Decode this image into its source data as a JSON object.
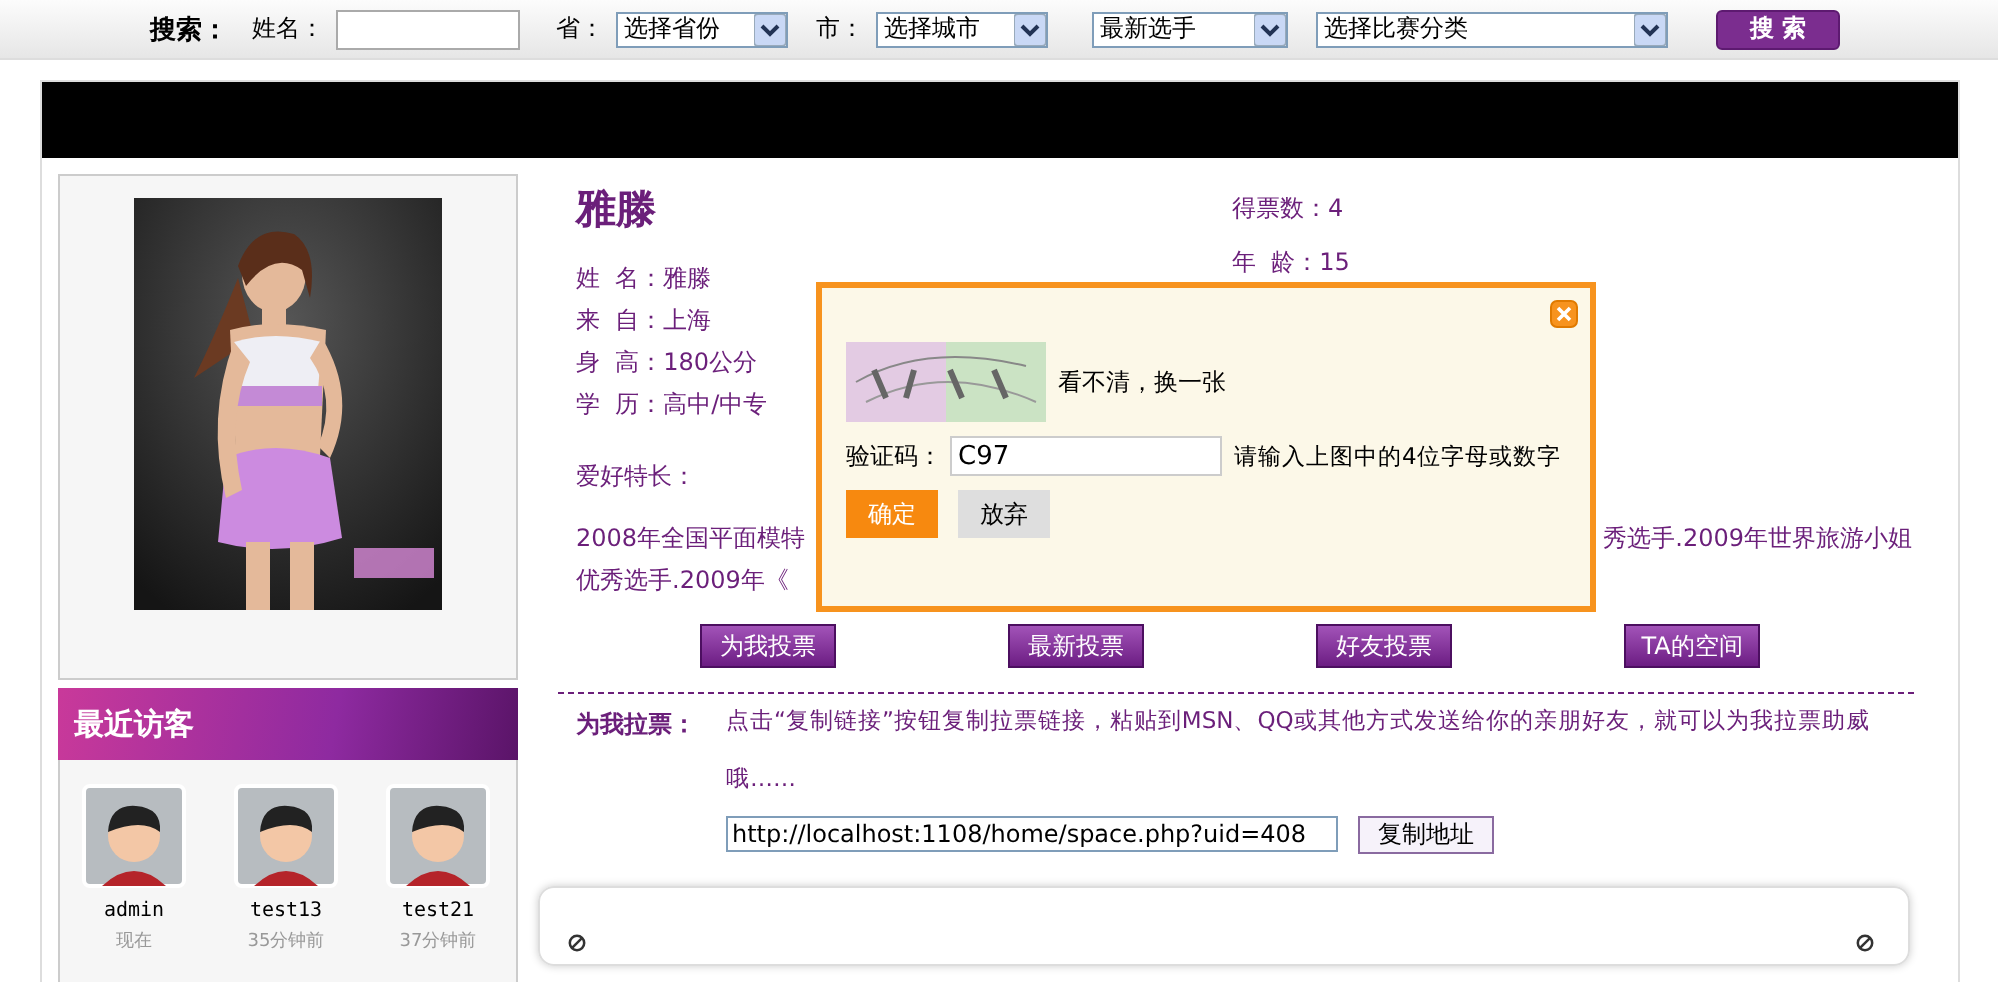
{
  "search_bar": {
    "title": "搜索：",
    "fields": [
      {
        "kind": "input",
        "label": "姓名："
      },
      {
        "kind": "select",
        "label": "省：",
        "value": "选择省份"
      },
      {
        "kind": "select",
        "label": "市：",
        "value": "选择城市"
      },
      {
        "kind": "select",
        "value": "最新选手"
      },
      {
        "kind": "select",
        "value": "选择比赛分类"
      }
    ],
    "button": "搜 索"
  },
  "visitors": {
    "title": "最近访客",
    "items": [
      {
        "name": "admin",
        "time": "现在"
      },
      {
        "name": "test13",
        "time": "35分钟前"
      },
      {
        "name": "test21",
        "time": "37分钟前"
      }
    ]
  },
  "profile": {
    "name": "雅滕",
    "votes": "得票数：4",
    "age": "年  龄：15",
    "details": [
      "姓  名：雅滕",
      "来  自：上海",
      "身  高：180公分",
      "学  历：高中/中专"
    ],
    "hobby_label": "爱好特长：",
    "hobby_lines": [
      {
        "left": "2008年全国平面模特",
        "right": "秀选手.2009年世界旅游小姐"
      },
      {
        "left": "优秀选手.2009年《"
      }
    ]
  },
  "actions": [
    "为我投票",
    "最新投票",
    "好友投票",
    "TA的空间"
  ],
  "vote_link": {
    "label": "为我拉票：",
    "text": "点击“复制链接”按钮复制拉票链接，粘贴到MSN、QQ或其他方式发送给你的亲朋好友，就可以为我拉票助威哦……",
    "url": "http://localhost:1108/home/space.php?uid=408",
    "button": "复制地址"
  },
  "dialog": {
    "refresh_link": "看不清，换一张",
    "label": "验证码：",
    "value": "C97",
    "hint": "请输入上图中的4位字母或数字",
    "buttons": [
      {
        "label": "确定",
        "kind": "primary"
      },
      {
        "label": "放弃",
        "kind": "secondary"
      }
    ]
  }
}
